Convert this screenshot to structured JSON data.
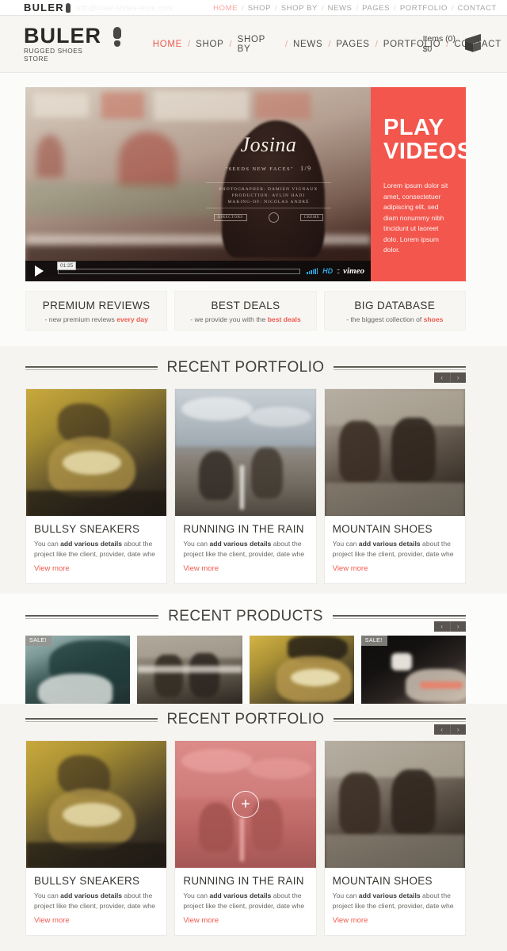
{
  "sticky": {
    "logo": "BULER",
    "email": "info@buler-shoes-store.com",
    "nav": [
      {
        "label": "HOME",
        "active": true
      },
      {
        "label": "SHOP",
        "active": false
      },
      {
        "label": "SHOP BY",
        "active": false
      },
      {
        "label": "NEWS",
        "active": false
      },
      {
        "label": "PAGES",
        "active": false
      },
      {
        "label": "PORTFOLIO",
        "active": false
      },
      {
        "label": "CONTACT",
        "active": false
      }
    ]
  },
  "header": {
    "logo_main": "BULER",
    "logo_sub": "RUGGED SHOES STORE",
    "nav": [
      {
        "label": "HOME",
        "active": true
      },
      {
        "label": "SHOP",
        "active": false
      },
      {
        "label": "SHOP BY",
        "active": false
      },
      {
        "label": "NEWS",
        "active": false
      },
      {
        "label": "PAGES",
        "active": false
      },
      {
        "label": "PORTFOLIO",
        "active": false
      },
      {
        "label": "CONTACT",
        "active": false
      }
    ],
    "cart": {
      "items_label": "Items (0)",
      "total_label": "$0",
      "icon": "box-icon"
    }
  },
  "hero": {
    "video": {
      "title": "Josina",
      "subtitle": "\"SEEDS NEW FACES\"",
      "fraction": "1/9",
      "credits": "PHOTOGRAPHER: DAMIEN VIGNAUX\nPRODUCTION: AYLIN HADI\nMAKING-OF: NICOLAS ANDRÉ",
      "credit_lines": [
        "PHOTOGRAPHER: DAMIEN VIGNAUX",
        "PRODUCTION: AYLIN HADI",
        "MAKING-OF: NICOLAS ANDRÉ"
      ],
      "brand_logos": [
        "DIRECTORS",
        "crown",
        "CREME"
      ],
      "player": {
        "time": "01:25",
        "hd_label": "HD",
        "provider": "vimeo",
        "play_icon": "play-icon"
      }
    },
    "panel": {
      "title_line1": "PLAY",
      "title_line2": "VIDEOS",
      "body": "Lorem ipsum dolor sit amet, consectetuer adipiscing elit, sed diam nonummy nibh tincidunt ut laoreet dolo. Lorem ipsum dolor.",
      "bg_color": "#f2564d"
    }
  },
  "features": [
    {
      "title": "PREMIUM REVIEWS",
      "text_pre": "- new premium reviews ",
      "highlight": "every day",
      "text_post": ""
    },
    {
      "title": "BEST DEALS",
      "text_pre": "- we provide you with the ",
      "highlight": "best deals",
      "text_post": ""
    },
    {
      "title": "BIG DATABASE",
      "text_pre": "- the biggest collection of ",
      "highlight": "shoes",
      "text_post": ""
    }
  ],
  "sections": {
    "portfolio_top": {
      "title": "RECENT PORTFOLIO",
      "prev_icon": "chevron-left-icon",
      "next_icon": "chevron-right-icon",
      "prev_label": "‹",
      "next_label": "›"
    },
    "products": {
      "title": "RECENT PRODUCTS",
      "prev_label": "‹",
      "next_label": "›"
    },
    "portfolio_bottom": {
      "title": "RECENT PORTFOLIO",
      "prev_label": "‹",
      "next_label": "›"
    }
  },
  "portfolio_items": [
    {
      "title": "BULLSY SNEAKERS",
      "desc_pre": "You can ",
      "desc_bold": "add various details",
      "desc_post": " about the project like the client, provider, date whe",
      "link": "View more",
      "image": "yellow-ground-sneaker"
    },
    {
      "title": "RUNNING IN THE RAIN",
      "desc_pre": "You can ",
      "desc_bold": "add various details",
      "desc_post": " about the project like the client, provider, date whe",
      "link": "View more",
      "image": "road-shoes"
    },
    {
      "title": "MOUNTAIN SHOES",
      "desc_pre": "You can ",
      "desc_bold": "add various details",
      "desc_post": " about the project like the client, provider, date whe",
      "link": "View more",
      "image": "hiking-boots"
    }
  ],
  "portfolio_items_bottom": [
    {
      "title": "BULLSY SNEAKERS",
      "desc_pre": "You can ",
      "desc_bold": "add various details",
      "desc_post": " about the project like the client, provider, date whe",
      "link": "View more",
      "image": "yellow-ground-sneaker",
      "hovered": false
    },
    {
      "title": "RUNNING IN THE RAIN",
      "desc_pre": "You can ",
      "desc_bold": "add various details",
      "desc_post": " about the project like the client, provider, date whe",
      "link": "View more",
      "image": "road-shoes",
      "hovered": true,
      "hover_icon": "plus-icon",
      "hover_label": "+"
    },
    {
      "title": "MOUNTAIN SHOES",
      "desc_pre": "You can ",
      "desc_bold": "add various details",
      "desc_post": " about the project like the client, provider, date whe",
      "link": "View more",
      "image": "hiking-boots",
      "hovered": false
    }
  ],
  "products": [
    {
      "sale": true,
      "sale_label": "SALE!",
      "image": "teal-sneaker-sole"
    },
    {
      "sale": false,
      "sale_label": "",
      "image": "gray-boots-pair"
    },
    {
      "sale": false,
      "sale_label": "",
      "image": "yellow-ground-boot"
    },
    {
      "sale": true,
      "sale_label": "SALE!",
      "image": "dark-sneaker"
    }
  ],
  "colors": {
    "accent": "#ef5a50",
    "hero_panel": "#f2564d",
    "header_bg": "#f7f6f2",
    "band_gray": "#f5f4f1",
    "text_dark": "#36342f"
  }
}
